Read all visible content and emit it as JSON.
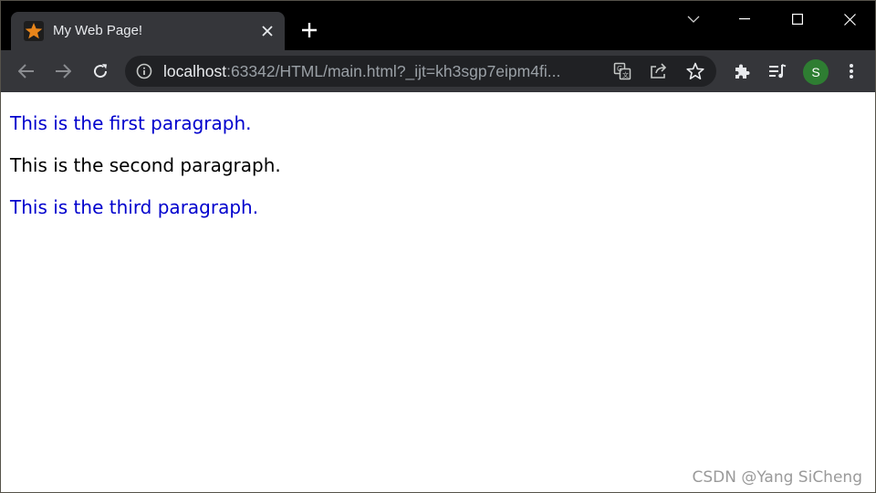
{
  "tab": {
    "title": "My Web Page!"
  },
  "address_bar": {
    "host": "localhost",
    "rest": ":63342/HTML/main.html?_ijt=kh3sgp7eipm4fi..."
  },
  "profile": {
    "initial": "S",
    "color": "#2e7d32"
  },
  "page": {
    "paragraphs": [
      {
        "text": "This is the first paragraph.",
        "color": "#0000cd"
      },
      {
        "text": "This is the second paragraph.",
        "color": "#000000"
      },
      {
        "text": "This is the third paragraph.",
        "color": "#0000cd"
      }
    ]
  },
  "watermark": "CSDN @Yang SiCheng",
  "icons": {
    "favicon": "star-icon",
    "close": "close-icon",
    "new_tab": "plus-icon",
    "back": "back-arrow-icon",
    "forward": "forward-arrow-icon",
    "reload": "reload-icon",
    "info": "info-icon",
    "translate": "translate-icon",
    "share": "share-icon",
    "bookmark": "star-outline-icon",
    "extensions": "puzzle-icon",
    "reading_list": "reading-list-icon",
    "menu": "kebab-menu-icon"
  }
}
